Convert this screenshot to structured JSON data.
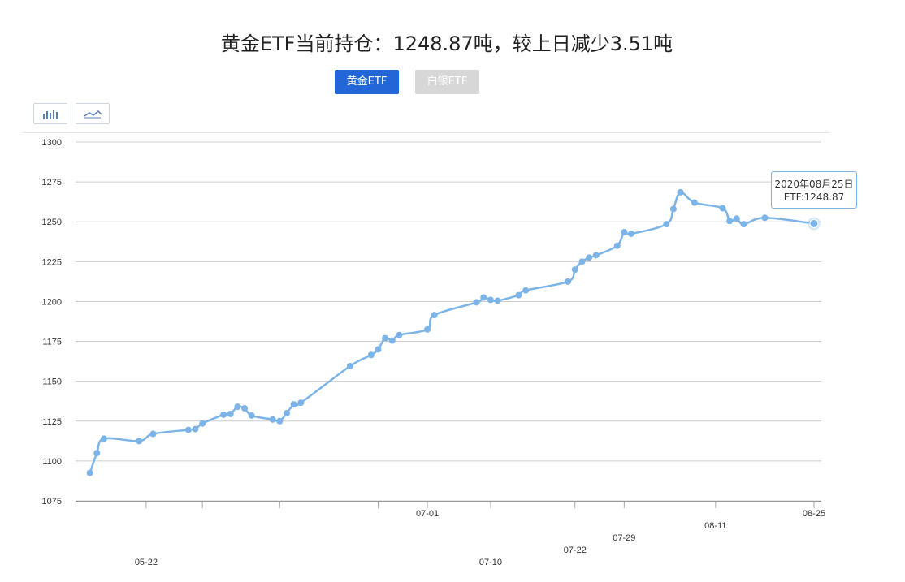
{
  "title": "黄金ETF当前持仓：1248.87吨，较上日减少3.51吨",
  "tabs": [
    {
      "label": "黄金ETF",
      "active": true,
      "color": "#2266d8"
    },
    {
      "label": "白银ETF",
      "active": false,
      "color": "#d7d7d7"
    }
  ],
  "toolbar": {
    "bar_icon": "bar-chart-icon",
    "line_icon": "line-chart-icon"
  },
  "tooltip": {
    "date": "2020年08月25日",
    "value": "ETF:1248.87"
  },
  "colors": {
    "line": "#7cb4e8",
    "grid": "#cccccc",
    "axis": "#333333"
  },
  "chart_data": {
    "type": "line",
    "ylim": [
      1075,
      1300
    ],
    "yticks": [
      1075,
      1100,
      1125,
      1150,
      1175,
      1200,
      1225,
      1250,
      1275,
      1300
    ],
    "xlim": [
      "2020-05-13",
      "2020-08-25"
    ],
    "xtick_labels": [
      {
        "date": "2020-05-22",
        "label": "05-22",
        "row": 2
      },
      {
        "date": "2020-07-01",
        "label": "07-01",
        "row": 0
      },
      {
        "date": "2020-07-10",
        "label": "07-10",
        "row": 2
      },
      {
        "date": "2020-07-22",
        "label": "07-22",
        "row": 1
      },
      {
        "date": "2020-07-29",
        "label": "07-29",
        "row": 1
      },
      {
        "date": "2020-08-11",
        "label": "08-11",
        "row": 0
      },
      {
        "date": "2020-08-25",
        "label": "08-25",
        "row": 0
      }
    ],
    "xtick_marks": [
      "2020-05-22",
      "2020-05-30",
      "2020-06-10",
      "2020-06-24",
      "2020-07-01",
      "2020-07-10",
      "2020-07-22",
      "2020-07-29",
      "2020-08-11",
      "2020-08-25"
    ],
    "series": [
      {
        "points": [
          [
            "2020-05-14",
            1092.5
          ],
          [
            "2020-05-15",
            1105
          ],
          [
            "2020-05-16",
            1114
          ],
          [
            "2020-05-21",
            1112.5
          ],
          [
            "2020-05-23",
            1117
          ],
          [
            "2020-05-28",
            1119.5
          ],
          [
            "2020-05-29",
            1120
          ],
          [
            "2020-05-30",
            1123.5
          ],
          [
            "2020-06-02",
            1129
          ],
          [
            "2020-06-03",
            1129.5
          ],
          [
            "2020-06-04",
            1134
          ],
          [
            "2020-06-05",
            1133
          ],
          [
            "2020-06-06",
            1128.5
          ],
          [
            "2020-06-09",
            1126
          ],
          [
            "2020-06-10",
            1125
          ],
          [
            "2020-06-11",
            1130
          ],
          [
            "2020-06-12",
            1135.5
          ],
          [
            "2020-06-13",
            1136.5
          ],
          [
            "2020-06-20",
            1159.5
          ],
          [
            "2020-06-23",
            1166.5
          ],
          [
            "2020-06-24",
            1170
          ],
          [
            "2020-06-25",
            1177
          ],
          [
            "2020-06-26",
            1175.5
          ],
          [
            "2020-06-27",
            1179
          ],
          [
            "2020-07-01",
            1182.5
          ],
          [
            "2020-07-02",
            1191.5
          ],
          [
            "2020-07-08",
            1199.5
          ],
          [
            "2020-07-09",
            1202.5
          ],
          [
            "2020-07-10",
            1201
          ],
          [
            "2020-07-11",
            1200.5
          ],
          [
            "2020-07-14",
            1204
          ],
          [
            "2020-07-15",
            1207
          ],
          [
            "2020-07-21",
            1212.5
          ],
          [
            "2020-07-22",
            1220
          ],
          [
            "2020-07-23",
            1225
          ],
          [
            "2020-07-24",
            1227.5
          ],
          [
            "2020-07-25",
            1229
          ],
          [
            "2020-07-28",
            1235
          ],
          [
            "2020-07-29",
            1243.5
          ],
          [
            "2020-07-30",
            1242.5
          ],
          [
            "2020-08-04",
            1248.5
          ],
          [
            "2020-08-05",
            1258
          ],
          [
            "2020-08-06",
            1268.5
          ],
          [
            "2020-08-08",
            1262
          ],
          [
            "2020-08-12",
            1258.5
          ],
          [
            "2020-08-13",
            1250.5
          ],
          [
            "2020-08-14",
            1252
          ],
          [
            "2020-08-15",
            1248.5
          ],
          [
            "2020-08-18",
            1252.5
          ],
          [
            "2020-08-25",
            1248.87
          ]
        ]
      }
    ]
  }
}
